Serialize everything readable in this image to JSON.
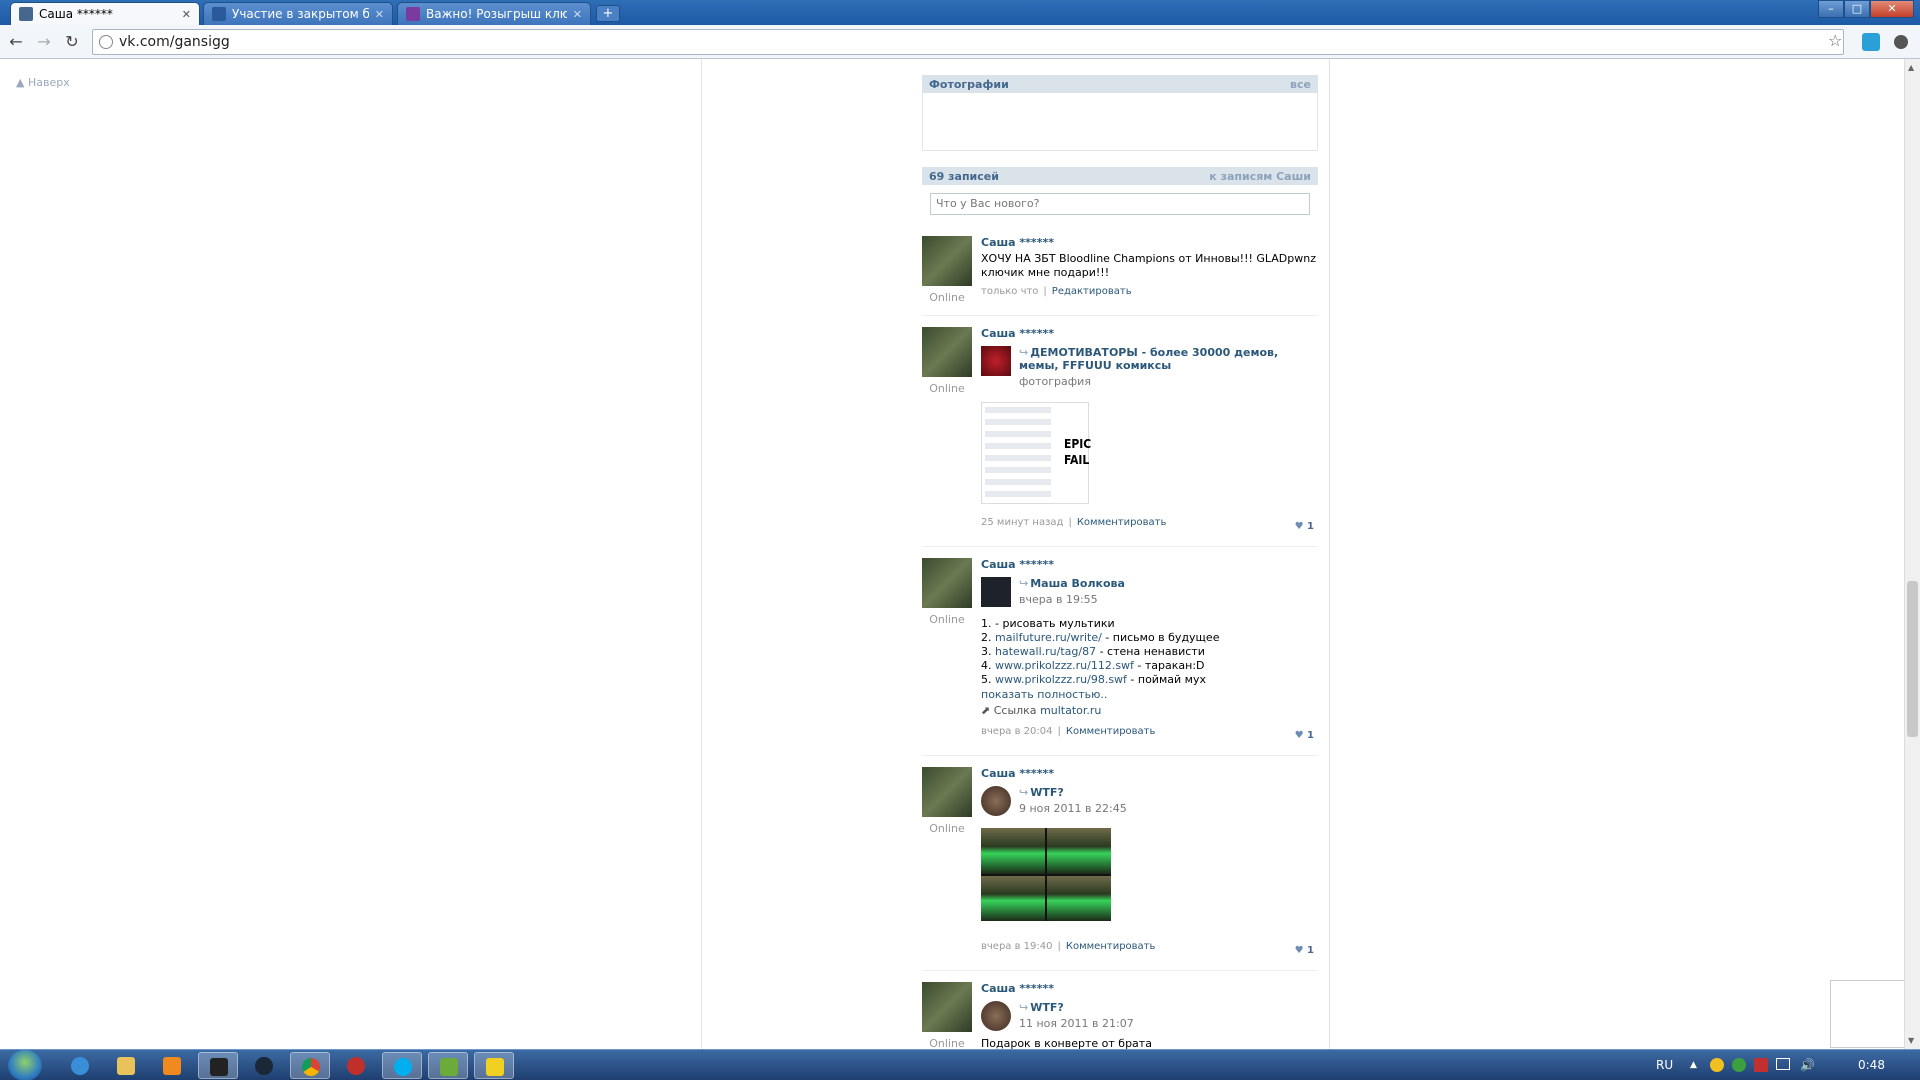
{
  "browser": {
    "tabs": [
      {
        "title": "Саша ******",
        "active": true,
        "icon_color": "#45688e"
      },
      {
        "title": "Участие в закрытом бета-т",
        "active": false,
        "icon_color": "#2a5a9a"
      },
      {
        "title": "Важно! Розыгрыш ключей",
        "active": false,
        "icon_color": "#7a3aa0"
      }
    ],
    "new_tab_label": "+",
    "url": "vk.com/gansigg",
    "window_buttons": {
      "minimize": "–",
      "maximize": "□",
      "close": "✕"
    }
  },
  "page": {
    "nav_top_label": "▲ Наверх",
    "photos": {
      "title": "Фотографии",
      "more": "все"
    },
    "posts_header": {
      "count": "69 записей",
      "link": "к записям Саши"
    },
    "status_placeholder": "Что у Вас нового?",
    "posts": [
      {
        "author": "Саша ******",
        "online": "Online",
        "text_lines": [
          "ХОЧУ НА ЗБТ Bloodline Champions от Инновы!!! GLADpwnz",
          "ключик мне подари!!!"
        ],
        "time": "только что",
        "action": "Редактировать"
      },
      {
        "author": "Саша ******",
        "online": "Online",
        "repost_title": "ДЕМОТИВАТОРЫ - более 30000 демов, мемы, FFFUUU комиксы",
        "repost_sub": "фотография",
        "pic_text": [
          "EPIC",
          "FAIL"
        ],
        "time": "25 минут назад",
        "action": "Комментировать",
        "likes": "1"
      },
      {
        "author": "Саша ******",
        "online": "Online",
        "repost_title": "Маша Волкова",
        "repost_sub": "вчера в 19:55",
        "list": [
          {
            "num": "1.",
            "link": "",
            "text": "- рисовать мультики"
          },
          {
            "num": "2.",
            "link": "mailfuture.ru/write/",
            "text": " - письмо в будущее"
          },
          {
            "num": "3.",
            "link": "hatewall.ru/tag/87",
            "text": " - стена ненависти"
          },
          {
            "num": "4.",
            "link": "www.prikolzzz.ru/112.swf",
            "text": " - таракан:D"
          },
          {
            "num": "5.",
            "link": "www.prikolzzz.ru/98.swf",
            "text": " - поймай мух"
          }
        ],
        "show_more": "показать полностью..",
        "link_label": "Ссылка",
        "link_domain": "multator.ru",
        "time": "вчера в 20:04",
        "action": "Комментировать",
        "likes": "1"
      },
      {
        "author": "Саша ******",
        "online": "Online",
        "repost_title": "WTF?",
        "repost_sub": "9 ноя 2011 в 22:45",
        "time": "вчера в 19:40",
        "action": "Комментировать",
        "likes": "1"
      },
      {
        "author": "Саша ******",
        "online": "Online",
        "repost_title": "WTF?",
        "repost_sub": "11 ноя 2011 в 21:07",
        "text_lines": [
          "Подарок в конверте от брата"
        ]
      }
    ]
  },
  "taskbar": {
    "language": "RU",
    "clock": "0:48",
    "items": [
      "ie-icon",
      "explorer-icon",
      "media-player-icon",
      "terminal-icon",
      "steam-icon",
      "chrome-icon",
      "app-red-icon",
      "skype-icon",
      "app-green-icon",
      "app-yellow-icon"
    ]
  }
}
